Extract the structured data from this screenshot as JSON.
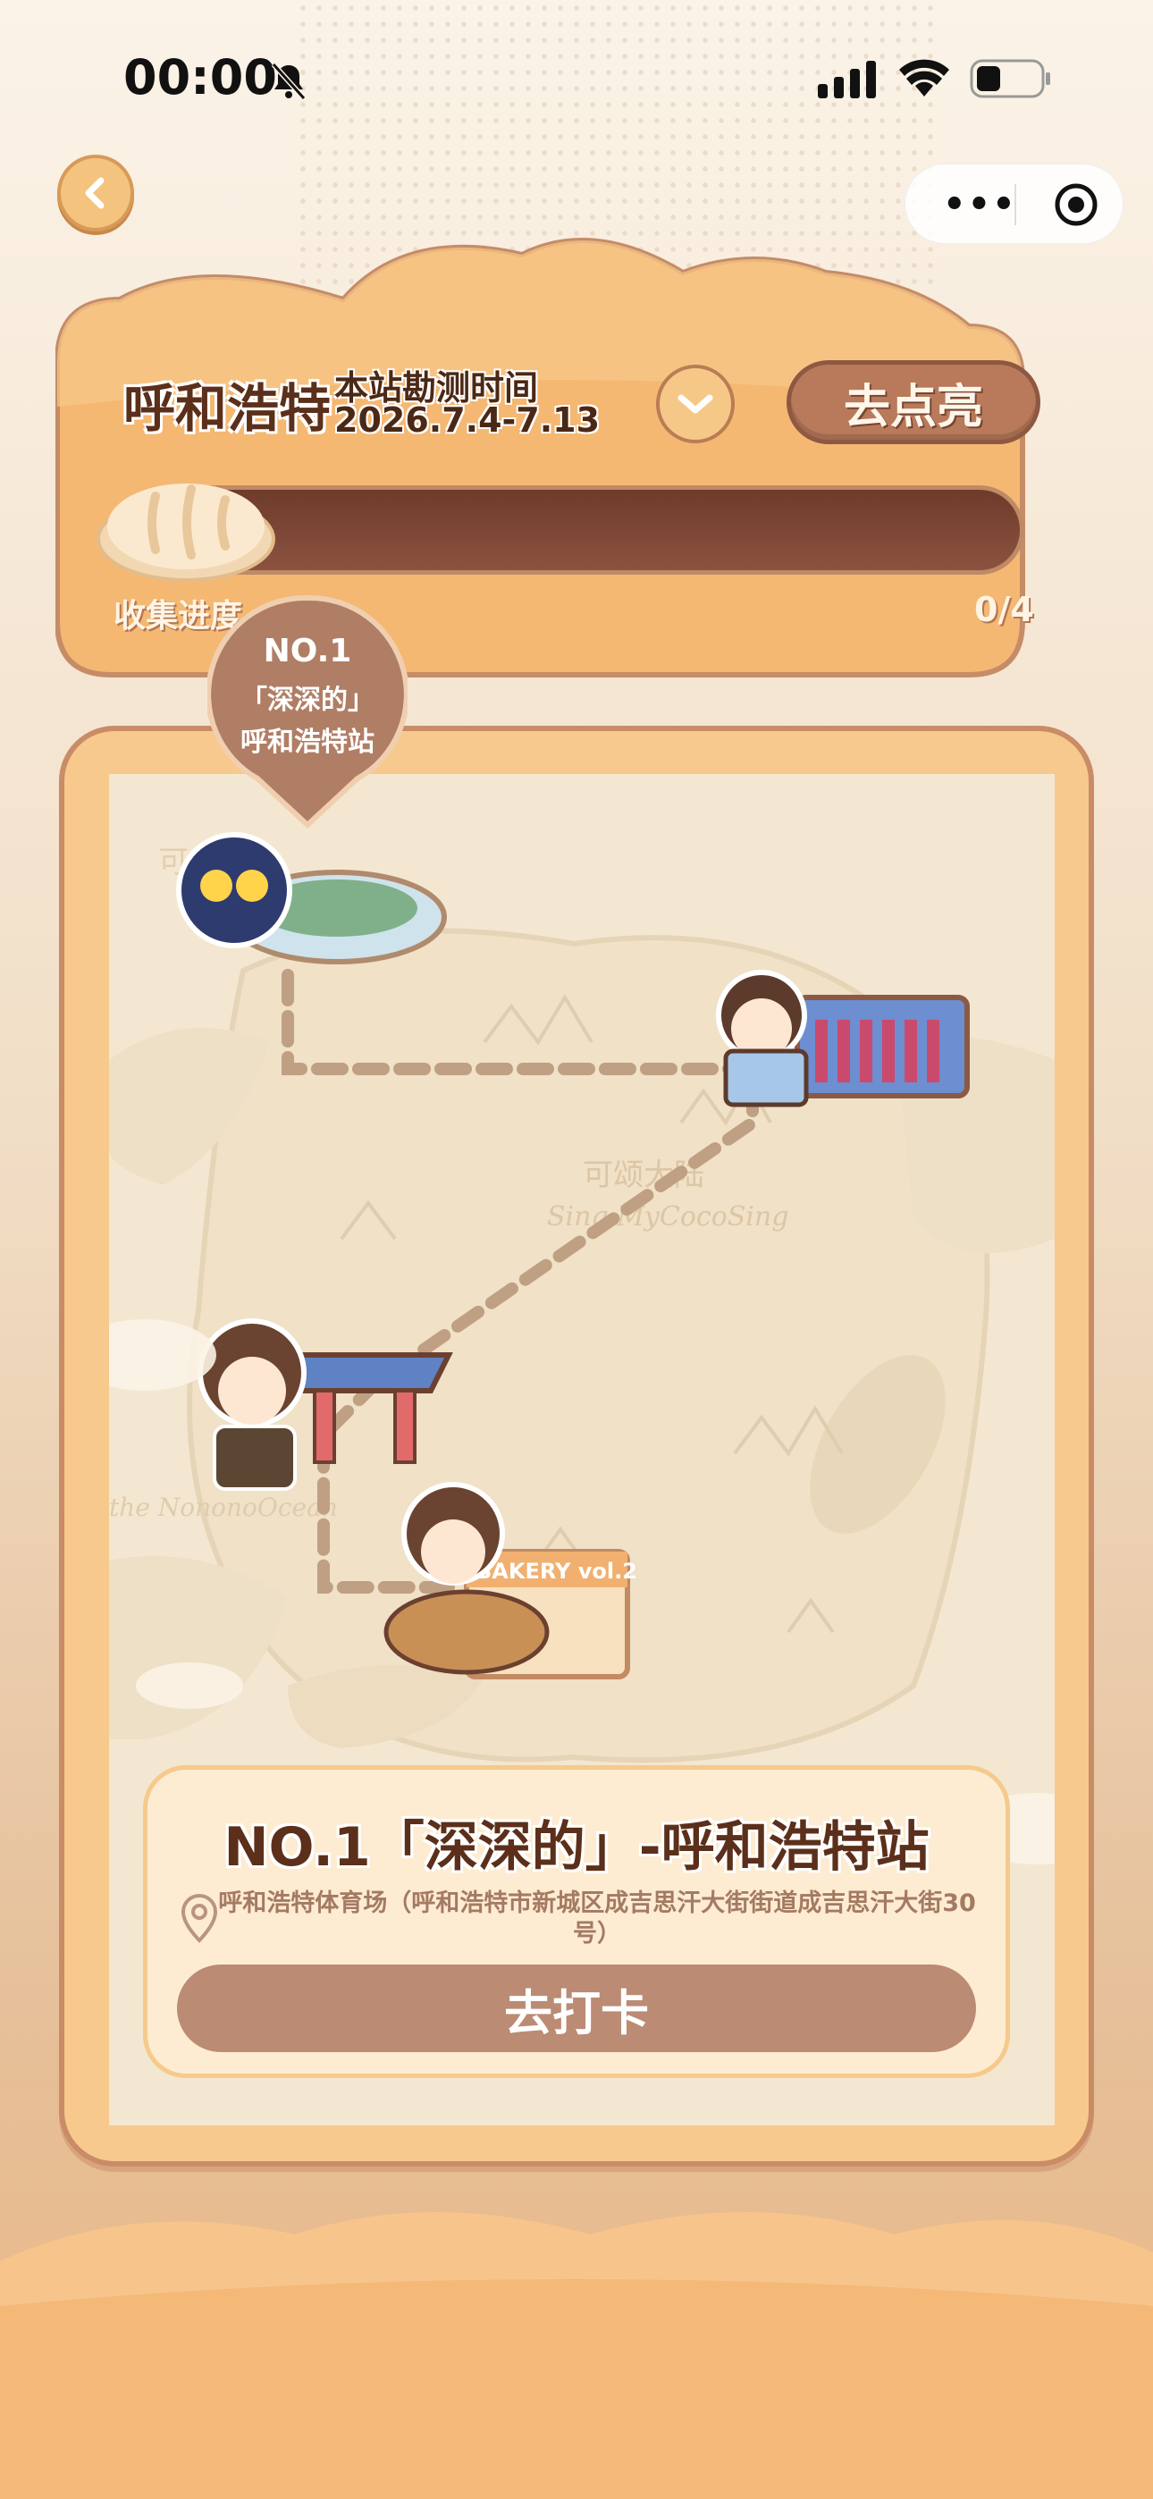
{
  "status_bar": {
    "time": "00:00",
    "icons": [
      "bell-muted-icon",
      "signal-icon",
      "wifi-icon",
      "battery-icon"
    ]
  },
  "nav": {
    "back_icon": "chevron-left-icon",
    "capsule_icons": [
      "more-icon",
      "target-icon"
    ]
  },
  "header": {
    "city": "呼和浩特",
    "period_label": "本站勘测时间",
    "period_dates": "2026.7.4-7.13",
    "dropdown_icon": "chevron-down-icon",
    "light_button": "去点亮",
    "progress_label": "收集进度",
    "progress_count": "0/4",
    "progress_value": 0
  },
  "pin": {
    "number": "NO.1",
    "name": "「深深的」",
    "station": "呼和浩特站"
  },
  "map": {
    "labels": [
      "可",
      "可颂大陆",
      "Sing MyCocoSing",
      "the NononoOcean",
      "BAKERY vol.2"
    ]
  },
  "info": {
    "title": "NO.1「深深的」-呼和浩特站",
    "address": "呼和浩特体育场（呼和浩特市新城区成吉思汗大街街道成吉思汗大街30号）",
    "checkin_button": "去打卡"
  },
  "colors": {
    "brand_orange": "#f4b873",
    "brown_dark": "#5b2f1a",
    "button_brown": "#bb8b74",
    "track": "#6e3b2a"
  }
}
